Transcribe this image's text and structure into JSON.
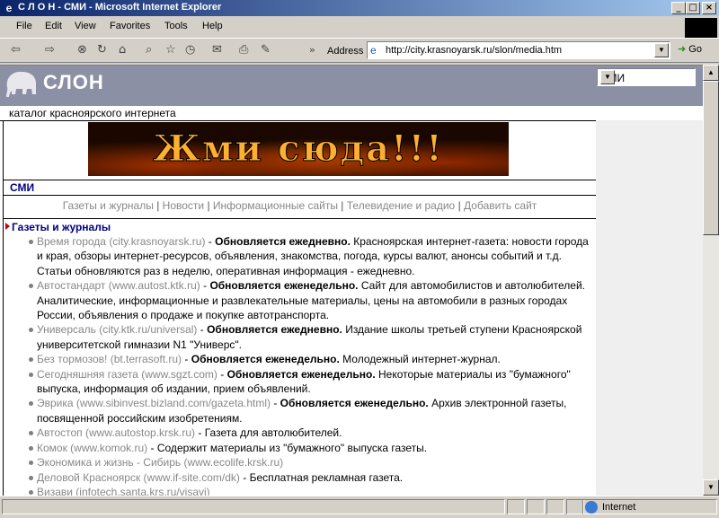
{
  "window": {
    "title": "С Л О Н - СМИ - Microsoft Internet Explorer",
    "controls": [
      "_",
      "□",
      "×"
    ]
  },
  "menu": [
    "File",
    "Edit",
    "View",
    "Favorites",
    "Tools",
    "Help"
  ],
  "toolbar": {
    "address_label": "Address",
    "url": "http://city.krasnoyarsk.ru/slon/media.htm",
    "go_label": "Go",
    "overflow": "»"
  },
  "site": {
    "logo_text": "СЛОН",
    "tagline": "каталог красноярского интернета",
    "section_select": "СМИ",
    "banner_text": "Жми сюда!!!",
    "section_heading": "СМИ",
    "categories": [
      "Газеты и журналы",
      "Новости",
      "Информационные сайты",
      "Телевидение и радио",
      "Добавить сайт"
    ],
    "category_separator": "|",
    "list_heading": "Газеты и журналы",
    "items": [
      {
        "link": "Время города (city.krasnoyarsk.ru)",
        "dash": " - ",
        "update": "Обновляется ежедневно.",
        "desc": " Красноярская интернет-газета: новости города и края, обзоры интернет-ресурсов, объявления, знакомства, погода, курсы валют, анонсы событий и т.д. Статьи обновляются раз в неделю, оперативная информация - ежедневно."
      },
      {
        "link": "Автостандарт (www.autost.ktk.ru)",
        "dash": " - ",
        "update": "Обновляется еженедельно.",
        "desc": " Сайт для автомобилистов и автолюбителей. Аналитические, информационные и развлекательные материалы, цены на автомобили в разных городах России, объявления о продаже и покупке автотранспорта."
      },
      {
        "link": "Универсаль (city.ktk.ru/universal)",
        "dash": " - ",
        "update": "Обновляется ежедневно.",
        "desc": " Издание школы третьей ступени Красноярской университетской гимназии N1 \"Универс\"."
      },
      {
        "link": "Без тормозов! (bt.terrasoft.ru)",
        "dash": " - ",
        "update": "Обновляется еженедельно.",
        "desc": " Молодежный интернет-журнал."
      },
      {
        "link": "Сегодняшняя газета (www.sgzt.com)",
        "dash": " - ",
        "update": "Обновляется еженедельно.",
        "desc": " Некоторые материалы из \"бумажного\" выпуска, информация об издании, прием объявлений."
      },
      {
        "link": "Эврика (www.sibinvest.bizland.com/gazeta.html)",
        "dash": " - ",
        "update": "Обновляется еженедельно.",
        "desc": " Архив электронной газеты, посвященной российским изобретениям."
      },
      {
        "link": "Автостоп (www.autostop.krsk.ru)",
        "dash": " - ",
        "update": "",
        "desc": "Газета для автолюбителей."
      },
      {
        "link": "Комок (www.komok.ru)",
        "dash": " - ",
        "update": "",
        "desc": "Содержит материалы из \"бумажного\" выпуска газеты."
      },
      {
        "link": "Экономика и жизнь - Сибирь (www.ecolife.krsk.ru)",
        "dash": "",
        "update": "",
        "desc": ""
      },
      {
        "link": "Деловой Красноярск (www.if-site.com/dk)",
        "dash": " - ",
        "update": "",
        "desc": "Бесплатная рекламная газета."
      },
      {
        "link": "Визави (infotech.santa.krs.ru/visavi)",
        "dash": "",
        "update": "",
        "desc": ""
      }
    ]
  },
  "status": {
    "zone": "Internet"
  },
  "colors": {
    "title_gradient_start": "#0a246a",
    "header_bg": "#8b90a4",
    "link_gray": "#888888",
    "heading_navy": "#000080"
  }
}
